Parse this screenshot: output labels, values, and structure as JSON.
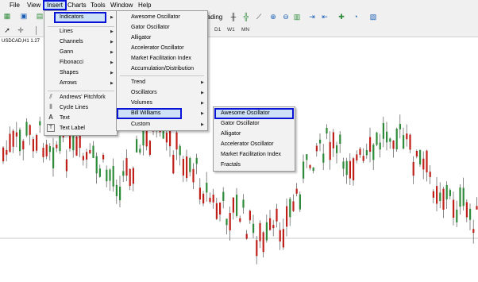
{
  "menubar": {
    "items": [
      "File",
      "View",
      "Insert",
      "Charts",
      "Tools",
      "Window",
      "Help"
    ]
  },
  "toolbar": {
    "trading_label": "rading",
    "timeframes": [
      "D1",
      "W1",
      "MN"
    ]
  },
  "chart": {
    "symbol_label": "USDCAD,H1 1.27"
  },
  "insert_menu": {
    "items": [
      "Indicators",
      "Lines",
      "Channels",
      "Gann",
      "Fibonacci",
      "Shapes",
      "Arrows",
      "Andrews' Pitchfork",
      "Cycle Lines",
      "Text",
      "Text Label"
    ],
    "text_icon": "A",
    "textlabel_icon": "T"
  },
  "indicators_menu": {
    "items": [
      "Awesome Oscillator",
      "Gator Oscillator",
      "Alligator",
      "Accelerator Oscillator",
      "Market Facilitation Index",
      "Accumulation/Distribution",
      "Trend",
      "Oscillators",
      "Volumes",
      "Bill Williams",
      "Custom"
    ]
  },
  "bill_williams_menu": {
    "items": [
      "Awesome Oscillator",
      "Gator Oscillator",
      "Alligator",
      "Accelerator Oscillator",
      "Market Facilitation Index",
      "Fractals"
    ]
  },
  "colors": {
    "highlight_border": "#0a14d6",
    "bull_candle": "#2e8b3a",
    "bear_candle": "#c0201a"
  }
}
